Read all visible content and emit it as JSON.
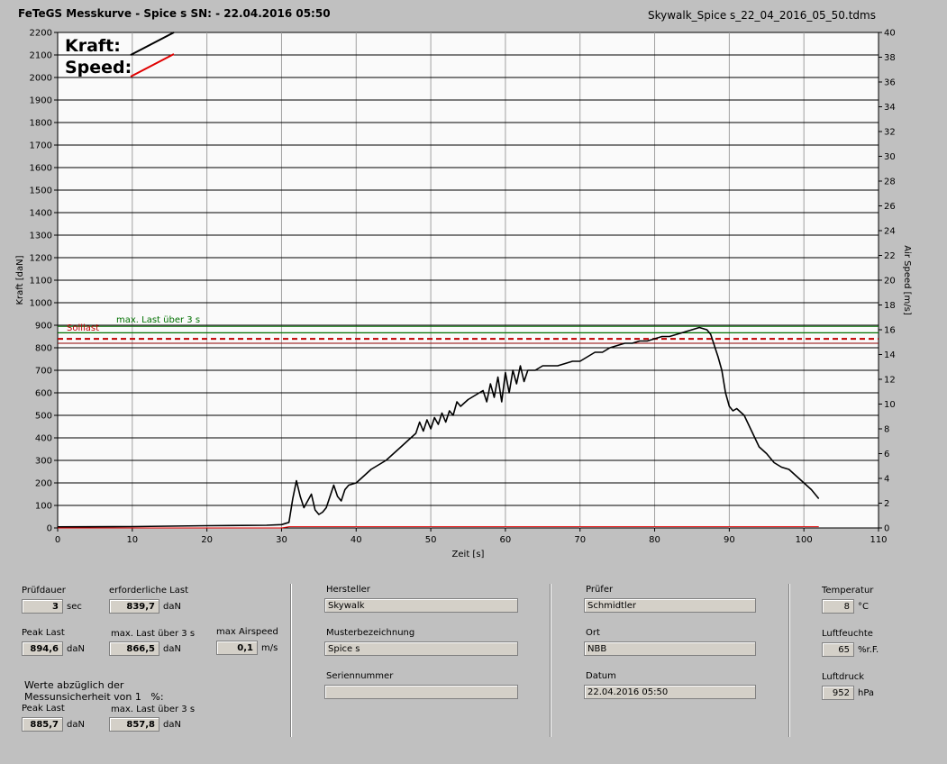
{
  "header": {
    "title": "FeTeGS Messkurve - Spice s  SN:  - 22.04.2016 05:50",
    "filename": "Skywalk_Spice s_22_04_2016_05_50.tdms"
  },
  "chart_data": {
    "type": "line",
    "xlabel": "Zeit [s]",
    "ylabel": "Kraft [daN]",
    "y2label": "Air Speed [m/s]",
    "xlim": [
      0,
      110
    ],
    "ylim": [
      0,
      2200
    ],
    "y2lim": [
      0,
      40
    ],
    "x_ticks": [
      0,
      10,
      20,
      30,
      40,
      50,
      60,
      70,
      80,
      90,
      100,
      110
    ],
    "y_ticks": [
      0,
      100,
      200,
      300,
      400,
      500,
      600,
      700,
      800,
      900,
      1000,
      1100,
      1200,
      1300,
      1400,
      1500,
      1600,
      1700,
      1800,
      1900,
      2000,
      2100,
      2200
    ],
    "y2_ticks": [
      0,
      2,
      4,
      6,
      8,
      10,
      12,
      14,
      16,
      18,
      20,
      22,
      24,
      26,
      28,
      30,
      32,
      34,
      36,
      38,
      40
    ],
    "grid": true,
    "legend": {
      "position": "top-left",
      "entries": [
        {
          "label": "Kraft:",
          "color": "#000000"
        },
        {
          "label": "Speed:",
          "color": "#e00000"
        }
      ]
    },
    "ref_lines": [
      {
        "label": "max. Last über  3 s",
        "value": 866.5,
        "color": "#007000",
        "style": "solid"
      },
      {
        "label": "Solllast",
        "value": 839.7,
        "color": "#c00000",
        "style": "dashed"
      }
    ],
    "series": [
      {
        "name": "Kraft",
        "color": "#000000",
        "x": [
          0,
          10,
          20,
          28,
          30,
          31,
          31.5,
          32,
          32.5,
          33,
          34,
          34.5,
          35,
          35.5,
          36,
          37,
          37.5,
          38,
          38.5,
          39,
          40,
          41,
          42,
          43,
          44,
          45,
          46,
          47,
          48,
          48.5,
          49,
          49.5,
          50,
          50.5,
          51,
          51.5,
          52,
          52.5,
          53,
          53.5,
          54,
          55,
          56,
          57,
          57.5,
          58,
          58.5,
          59,
          59.5,
          60,
          60.5,
          61,
          61.5,
          62,
          62.5,
          63,
          64,
          65,
          66,
          67,
          68,
          69,
          70,
          71,
          72,
          73,
          74,
          75,
          76,
          77,
          78,
          79,
          80,
          81,
          82,
          83,
          84,
          85,
          86,
          87,
          87.5,
          88,
          88.5,
          89,
          89.5,
          90,
          90.5,
          91,
          92,
          93,
          94,
          95,
          96,
          97,
          98,
          99,
          100,
          101,
          102
        ],
        "values": [
          5,
          6,
          10,
          12,
          15,
          25,
          130,
          210,
          140,
          90,
          150,
          80,
          60,
          70,
          90,
          190,
          140,
          120,
          170,
          190,
          200,
          230,
          260,
          280,
          300,
          330,
          360,
          390,
          420,
          470,
          430,
          480,
          440,
          490,
          460,
          510,
          470,
          520,
          500,
          560,
          540,
          570,
          590,
          610,
          560,
          640,
          580,
          670,
          560,
          690,
          600,
          700,
          640,
          720,
          650,
          700,
          700,
          720,
          720,
          720,
          730,
          740,
          740,
          760,
          780,
          780,
          800,
          810,
          820,
          820,
          830,
          830,
          840,
          850,
          850,
          860,
          870,
          880,
          890,
          880,
          860,
          810,
          760,
          700,
          600,
          540,
          520,
          530,
          500,
          430,
          360,
          330,
          290,
          270,
          260,
          230,
          200,
          170,
          130
        ]
      },
      {
        "name": "Speed",
        "color": "#e00000",
        "x": [
          0,
          30,
          31,
          102
        ],
        "values": [
          0,
          0,
          0.1,
          0.1
        ]
      }
    ]
  },
  "panel": {
    "pruefdauer": {
      "label": "Prüfdauer",
      "value": "3",
      "unit": "sec"
    },
    "erforderliche_last": {
      "label": "erforderliche Last",
      "value": "839,7",
      "unit": "daN"
    },
    "peak_last": {
      "label": "Peak Last",
      "value": "894,6",
      "unit": "daN"
    },
    "max_last": {
      "label": "max. Last über  3 s",
      "value": "866,5",
      "unit": "daN"
    },
    "max_airspeed": {
      "label": "max Airspeed",
      "value": "0,1",
      "unit": "m/s"
    },
    "werte_note": "Werte abzüglich der\nMessunsicherheit von 1   %:",
    "peak_last2": {
      "label": "Peak Last",
      "value": "885,7",
      "unit": "daN"
    },
    "max_last2": {
      "label": "max. Last über  3 s",
      "value": "857,8",
      "unit": "daN"
    },
    "hersteller": {
      "label": "Hersteller",
      "value": "Skywalk"
    },
    "musterbezeichnung": {
      "label": "Musterbezeichnung",
      "value": "Spice s"
    },
    "seriennummer": {
      "label": "Seriennummer",
      "value": ""
    },
    "pruefer": {
      "label": "Prüfer",
      "value": "Schmidtler"
    },
    "ort": {
      "label": "Ort",
      "value": "NBB"
    },
    "datum": {
      "label": "Datum",
      "value": "22.04.2016 05:50"
    },
    "temperatur": {
      "label": "Temperatur",
      "value": "8",
      "unit": "°C"
    },
    "luftfeuchte": {
      "label": "Luftfeuchte",
      "value": "65",
      "unit": "%r.F."
    },
    "luftdruck": {
      "label": "Luftdruck",
      "value": "952",
      "unit": "hPa"
    }
  }
}
